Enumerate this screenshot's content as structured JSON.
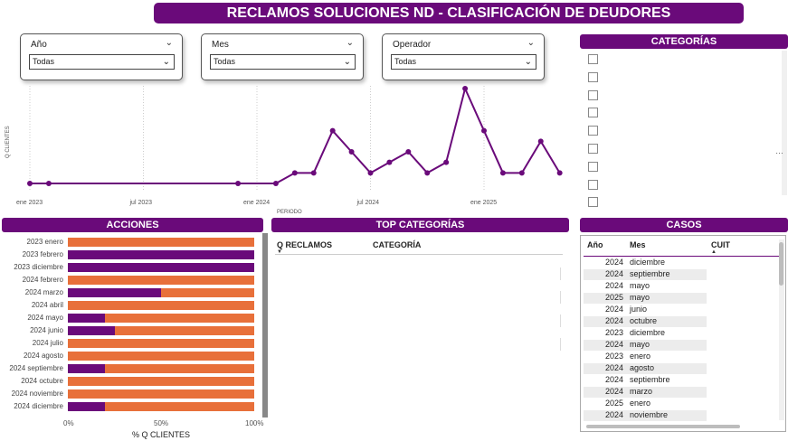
{
  "title": "RECLAMOS SOLUCIONES ND - CLASIFICACIÓN DE DEUDORES",
  "filters": [
    {
      "label": "Año",
      "value": "Todas"
    },
    {
      "label": "Mes",
      "value": "Todas"
    },
    {
      "label": "Operador",
      "value": "Todas"
    }
  ],
  "sections": {
    "categorias": "CATEGORÍAS",
    "acciones": "ACCIONES",
    "top_categorias": "TOP CATEGORÍAS",
    "casos": "CASOS"
  },
  "top_categorias": {
    "col1": "Q RECLAMOS",
    "col2": "CATEGORÍA"
  },
  "casos": {
    "headers": {
      "year": "Año",
      "month": "Mes",
      "cuit": "CUIT"
    },
    "rows": [
      {
        "year": "2024",
        "month": "diciembre"
      },
      {
        "year": "2024",
        "month": "septiembre"
      },
      {
        "year": "2024",
        "month": "mayo"
      },
      {
        "year": "2025",
        "month": "mayo"
      },
      {
        "year": "2024",
        "month": "junio"
      },
      {
        "year": "2024",
        "month": "octubre"
      },
      {
        "year": "2023",
        "month": "diciembre"
      },
      {
        "year": "2024",
        "month": "mayo"
      },
      {
        "year": "2023",
        "month": "enero"
      },
      {
        "year": "2024",
        "month": "agosto"
      },
      {
        "year": "2024",
        "month": "septiembre"
      },
      {
        "year": "2024",
        "month": "marzo"
      },
      {
        "year": "2025",
        "month": "enero"
      },
      {
        "year": "2024",
        "month": "noviembre"
      }
    ]
  },
  "colors": {
    "purple": "#6a0a7a",
    "orange": "#e8703a"
  },
  "chart_data": [
    {
      "type": "line",
      "ylabel": "Q CLIENTES",
      "xlabel": "PERIODO",
      "x_ticks": [
        "ene 2023",
        "jul 2023",
        "ene 2024",
        "jul 2024",
        "ene 2025"
      ],
      "x": [
        "2023-01",
        "2023-02",
        "2023-12",
        "2024-02",
        "2024-03",
        "2024-04",
        "2024-05",
        "2024-06",
        "2024-07",
        "2024-08",
        "2024-09",
        "2024-10",
        "2024-11",
        "2024-12",
        "2025-01",
        "2025-02",
        "2025-03",
        "2025-04",
        "2025-05"
      ],
      "values": [
        0,
        0,
        0,
        0,
        1,
        1,
        5,
        3,
        1,
        2,
        3,
        1,
        2,
        9,
        5,
        1,
        1,
        4,
        1
      ],
      "grid": true
    },
    {
      "type": "bar",
      "orientation": "horizontal-stacked-100",
      "xlabel": "% Q CLIENTES",
      "x_ticks": [
        "0%",
        "50%",
        "100%"
      ],
      "categories": [
        "2023 enero",
        "2023 febrero",
        "2023 diciembre",
        "2024 febrero",
        "2024 marzo",
        "2024 abril",
        "2024 mayo",
        "2024 junio",
        "2024 julio",
        "2024 agosto",
        "2024 septiembre",
        "2024 octubre",
        "2024 noviembre",
        "2024 diciembre"
      ],
      "series": [
        {
          "values": [
            0,
            100,
            100,
            0,
            50,
            0,
            20,
            25,
            0,
            0,
            20,
            0,
            0,
            20
          ]
        },
        {
          "values": [
            100,
            0,
            0,
            100,
            50,
            100,
            80,
            75,
            100,
            100,
            80,
            100,
            100,
            80
          ]
        }
      ]
    }
  ]
}
